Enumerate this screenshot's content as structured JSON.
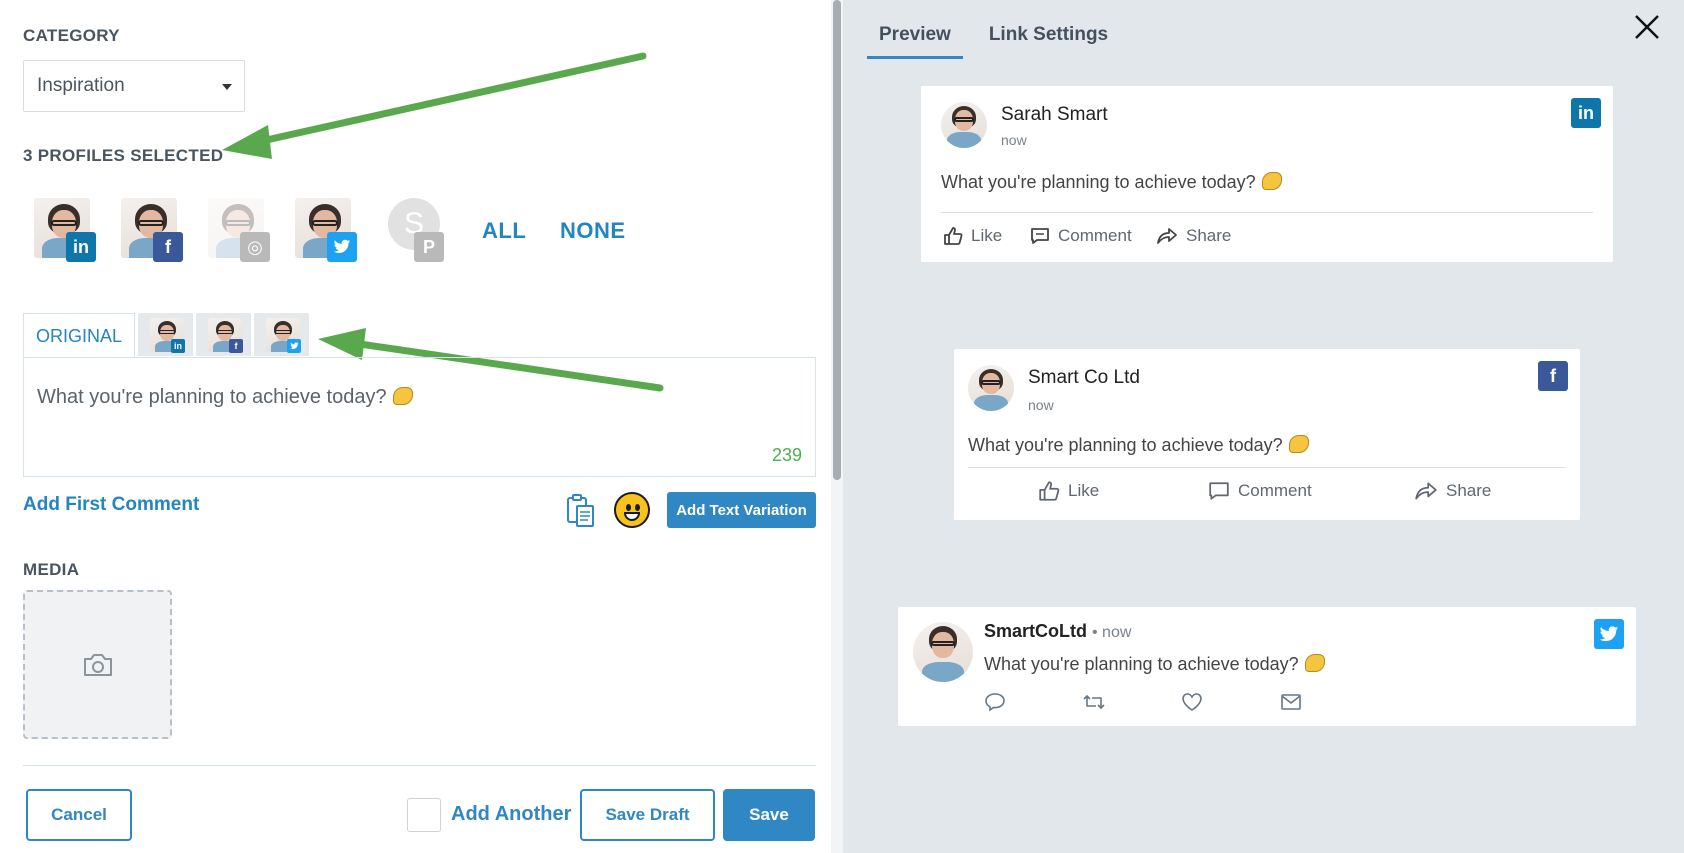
{
  "editor_panel": {
    "category_label": "CATEGORY",
    "category_value": "Inspiration",
    "profiles_label": "3 PROFILES SELECTED",
    "profiles": [
      {
        "network": "linkedin",
        "badge": "in"
      },
      {
        "network": "facebook",
        "badge": "f"
      },
      {
        "network": "instagram",
        "badge": "◎"
      },
      {
        "network": "twitter",
        "badge": "🐦"
      },
      {
        "network": "pinterest",
        "initial": "S",
        "badge": "P"
      }
    ],
    "select_all": "ALL",
    "select_none": "NONE",
    "tab_original": "ORIGINAL",
    "post_text": "What you're planning to achieve today?",
    "char_count": "239",
    "add_first_comment": "Add First Comment",
    "add_text_variation": "Add Text Variation",
    "media_label": "MEDIA",
    "cancel": "Cancel",
    "add_another": "Add Another",
    "save_draft": "Save Draft",
    "save": "Save"
  },
  "preview_panel": {
    "tabs": [
      "Preview",
      "Link Settings"
    ],
    "linkedin": {
      "name": "Sarah Smart",
      "time": "now",
      "text": "What you're planning to achieve today?",
      "actions": [
        "Like",
        "Comment",
        "Share"
      ]
    },
    "facebook": {
      "name": "Smart Co Ltd",
      "time": "now",
      "text": "What you're planning to achieve today?",
      "actions": [
        "Like",
        "Comment",
        "Share"
      ]
    },
    "twitter": {
      "name": "SmartCoLtd",
      "time": "• now",
      "text": "What you're planning to achieve today?"
    }
  },
  "colors": {
    "accent": "#2f87c4",
    "linkedin": "#0e76a8",
    "facebook": "#3b5998",
    "twitter": "#1da1f2",
    "count_green": "#4caf50"
  }
}
